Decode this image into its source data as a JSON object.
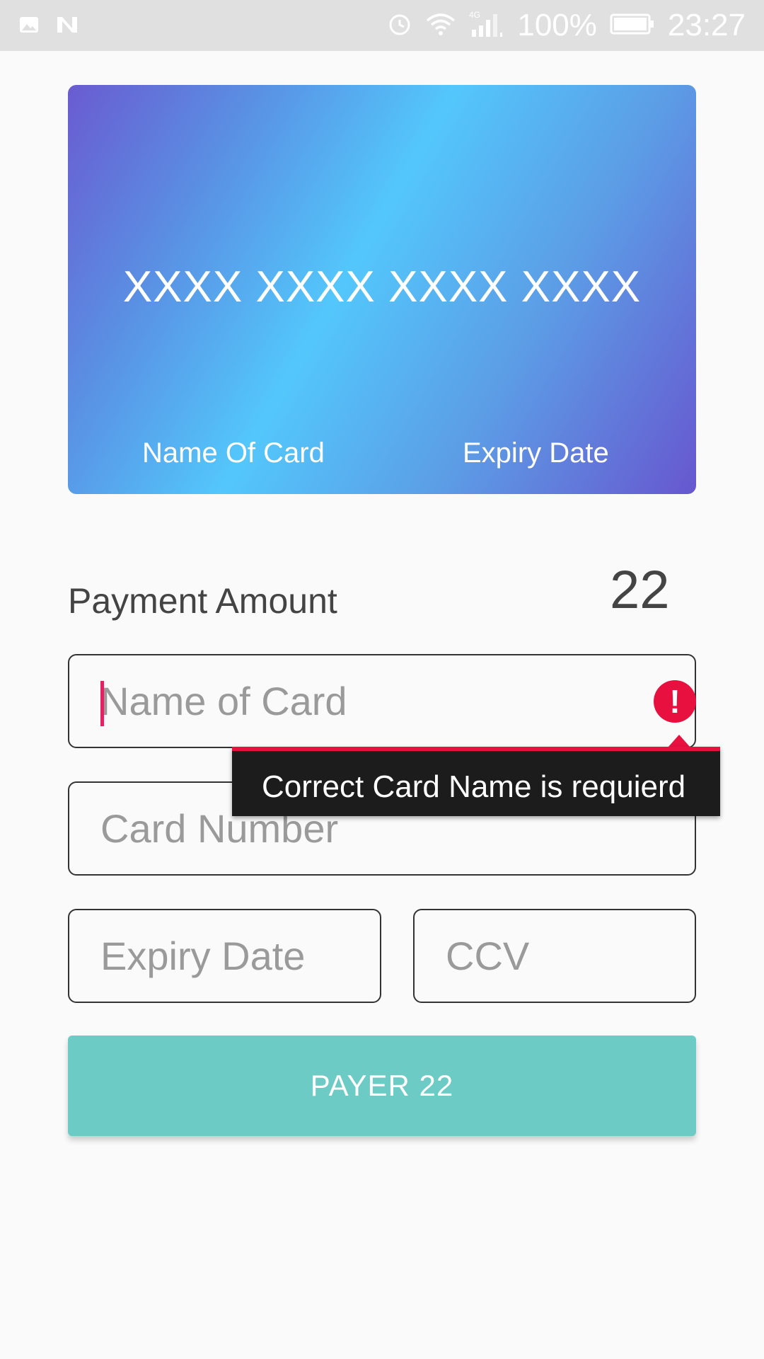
{
  "status_bar": {
    "left_icons": [
      "image-icon",
      "n-notification-icon"
    ],
    "right_icons": [
      "alarm-icon",
      "wifi-icon",
      "signal-4g-icon",
      "battery-icon"
    ],
    "network_label": "4G",
    "battery": "100%",
    "time": "23:27"
  },
  "card": {
    "number": "XXXX XXXX XXXX XXXX",
    "name": "Name Of Card",
    "expiry": "Expiry Date",
    "gradient_colors": [
      "#6a5bd1",
      "#53c7fb",
      "#6757cf"
    ]
  },
  "payment": {
    "label": "Payment Amount",
    "amount": "22"
  },
  "form": {
    "name_placeholder": "Name of Card",
    "number_placeholder": "Card Number",
    "expiry_placeholder": "Expiry Date",
    "ccv_placeholder": "CCV",
    "error_tooltip": "Correct Card Name is requierd",
    "error_color": "#e8103f"
  },
  "button": {
    "label": "PAYER 22",
    "color": "#6ccbc5"
  }
}
